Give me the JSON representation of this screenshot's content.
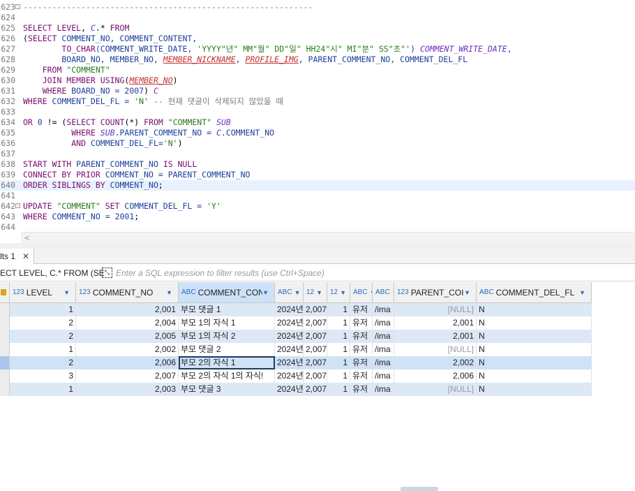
{
  "editor": {
    "lines": [
      {
        "n": "623",
        "fold": "-",
        "tokens": [
          {
            "t": "dash",
            "v": "------------------------------------------------------------"
          }
        ]
      },
      {
        "n": "624",
        "tokens": []
      },
      {
        "n": "625",
        "tokens": [
          {
            "t": "kw",
            "v": "SELECT LEVEL"
          },
          {
            "t": "p",
            "v": ", "
          },
          {
            "t": "al",
            "v": "C"
          },
          {
            "t": "p",
            "v": ".* "
          },
          {
            "t": "kw",
            "v": "FROM"
          }
        ]
      },
      {
        "n": "626",
        "tokens": [
          {
            "t": "p",
            "v": "("
          },
          {
            "t": "kw",
            "v": "SELECT"
          },
          {
            "t": "id",
            "v": " COMMENT_NO, COMMENT_CONTENT,"
          }
        ]
      },
      {
        "n": "627",
        "tokens": [
          {
            "t": "p",
            "v": "        "
          },
          {
            "t": "kw",
            "v": "TO_CHAR"
          },
          {
            "t": "id",
            "v": "(COMMENT_WRITE_DATE, "
          },
          {
            "t": "str",
            "v": "'YYYY\"년\" MM\"월\" DD\"일\" HH24\"시\" MI\"분\" SS\"초\"'"
          },
          {
            "t": "id",
            "v": ") "
          },
          {
            "t": "al",
            "v": "COMMENT_WRITE_DATE"
          },
          {
            "t": "id",
            "v": ","
          }
        ]
      },
      {
        "n": "628",
        "tokens": [
          {
            "t": "id",
            "v": "        BOARD_NO, MEMBER_NO, "
          },
          {
            "t": "er",
            "v": "MEMBER_NICKNAME"
          },
          {
            "t": "id",
            "v": ", "
          },
          {
            "t": "er",
            "v": "PROFILE_IMG"
          },
          {
            "t": "id",
            "v": ", PARENT_COMMENT_NO, COMMENT_DEL_FL"
          }
        ]
      },
      {
        "n": "629",
        "tokens": [
          {
            "t": "kw",
            "v": "    FROM "
          },
          {
            "t": "str",
            "v": "\"COMMENT\""
          }
        ]
      },
      {
        "n": "630",
        "tokens": [
          {
            "t": "kw",
            "v": "    JOIN MEMBER USING"
          },
          {
            "t": "p",
            "v": "("
          },
          {
            "t": "er",
            "v": "MEMBER_NO"
          },
          {
            "t": "p",
            "v": ")"
          }
        ]
      },
      {
        "n": "631",
        "tokens": [
          {
            "t": "kw",
            "v": "    WHERE"
          },
          {
            "t": "id",
            "v": " BOARD_NO = "
          },
          {
            "t": "nm",
            "v": "2007"
          },
          {
            "t": "p",
            "v": ") "
          },
          {
            "t": "al",
            "v": "C"
          }
        ]
      },
      {
        "n": "632",
        "tokens": [
          {
            "t": "kw",
            "v": "WHERE"
          },
          {
            "t": "id",
            "v": " COMMENT_DEL_FL = "
          },
          {
            "t": "str",
            "v": "'N'"
          },
          {
            "t": "cm",
            "v": " -- 현재 댓글이 삭제되지 않았을 때"
          }
        ]
      },
      {
        "n": "633",
        "tokens": []
      },
      {
        "n": "634",
        "tokens": [
          {
            "t": "kw",
            "v": "OR "
          },
          {
            "t": "nm",
            "v": "0"
          },
          {
            "t": "p",
            "v": " != ("
          },
          {
            "t": "kw",
            "v": "SELECT COUNT"
          },
          {
            "t": "p",
            "v": "(*) "
          },
          {
            "t": "kw",
            "v": "FROM "
          },
          {
            "t": "str",
            "v": "\"COMMENT\""
          },
          {
            "t": "p",
            "v": " "
          },
          {
            "t": "al",
            "v": "SUB"
          }
        ]
      },
      {
        "n": "635",
        "tokens": [
          {
            "t": "kw",
            "v": "          WHERE "
          },
          {
            "t": "al",
            "v": "SUB"
          },
          {
            "t": "id",
            "v": ".PARENT_COMMENT_NO = "
          },
          {
            "t": "al",
            "v": "C"
          },
          {
            "t": "id",
            "v": ".COMMENT_NO"
          }
        ]
      },
      {
        "n": "636",
        "tokens": [
          {
            "t": "kw",
            "v": "          AND"
          },
          {
            "t": "id",
            "v": " COMMENT_DEL_FL="
          },
          {
            "t": "str",
            "v": "'N'"
          },
          {
            "t": "p",
            "v": ")"
          }
        ]
      },
      {
        "n": "637",
        "tokens": []
      },
      {
        "n": "638",
        "tokens": [
          {
            "t": "kw",
            "v": "START WITH"
          },
          {
            "t": "id",
            "v": " PARENT_COMMENT_NO "
          },
          {
            "t": "kw",
            "v": "IS NULL"
          }
        ]
      },
      {
        "n": "639",
        "tokens": [
          {
            "t": "kw",
            "v": "CONNECT BY PRIOR"
          },
          {
            "t": "id",
            "v": " COMMENT_NO = PARENT_COMMENT_NO"
          }
        ]
      },
      {
        "n": "640",
        "hl": true,
        "tokens": [
          {
            "t": "kw",
            "v": "ORDER SIBLINGS BY"
          },
          {
            "t": "id",
            "v": " COMMENT_NO"
          },
          {
            "t": "p",
            "v": ";"
          }
        ]
      },
      {
        "n": "641",
        "tokens": []
      },
      {
        "n": "642",
        "fold": "-",
        "tokens": [
          {
            "t": "kw",
            "v": "UPDATE "
          },
          {
            "t": "str",
            "v": "\"COMMENT\""
          },
          {
            "t": "kw",
            "v": " SET"
          },
          {
            "t": "id",
            "v": " COMMENT_DEL_FL = "
          },
          {
            "t": "str",
            "v": "'Y'"
          }
        ]
      },
      {
        "n": "643",
        "tokens": [
          {
            "t": "kw",
            "v": "WHERE"
          },
          {
            "t": "id",
            "v": " COMMENT_NO = "
          },
          {
            "t": "nm",
            "v": "2001"
          },
          {
            "t": "p",
            "v": ";"
          }
        ]
      },
      {
        "n": "644",
        "tokens": []
      }
    ]
  },
  "results_tab": {
    "label": "lts 1"
  },
  "filter": {
    "query_text": "ECT LEVEL, C.* FROM (SE",
    "placeholder": "Enter a SQL expression to filter results (use Ctrl+Space)"
  },
  "grid": {
    "columns": [
      {
        "type": "123",
        "label": "LEVEL"
      },
      {
        "type": "123",
        "label": "COMMENT_NO"
      },
      {
        "type": "ABC",
        "label": "COMMENT_CON"
      },
      {
        "type": "ABC",
        "label": ""
      },
      {
        "type": "12",
        "label": ""
      },
      {
        "type": "12",
        "label": ""
      },
      {
        "type": "ABC",
        "label": ""
      },
      {
        "type": "ABC",
        "label": ""
      },
      {
        "type": "123",
        "label": "PARENT_COI"
      },
      {
        "type": "ABC",
        "label": "COMMENT_DEL_FL"
      }
    ],
    "rows": [
      [
        "1",
        "2,001",
        "부모 댓글 1",
        "2024년",
        "2,007",
        "1",
        "유저",
        "/ima",
        "[NULL]",
        "N"
      ],
      [
        "2",
        "2,004",
        "부모 1의 자식 1",
        "2024년",
        "2,007",
        "1",
        "유저",
        "/ima",
        "2,001",
        "N"
      ],
      [
        "2",
        "2,005",
        "부모 1의 자식 2",
        "2024년",
        "2,007",
        "1",
        "유저",
        "/ima",
        "2,001",
        "N"
      ],
      [
        "1",
        "2,002",
        "부모 댓글 2",
        "2024년",
        "2,007",
        "1",
        "유저",
        "/ima",
        "[NULL]",
        "N"
      ],
      [
        "2",
        "2,006",
        "부모 2의 자식 1",
        "2024년",
        "2,007",
        "1",
        "유저",
        "/ima",
        "2,002",
        "N"
      ],
      [
        "3",
        "2,007",
        "부모 2의 자식 1의 자식!",
        "2024년",
        "2,007",
        "1",
        "유저",
        "/ima",
        "2,006",
        "N"
      ],
      [
        "1",
        "2,003",
        "부모 댓글 3",
        "2024년",
        "2,007",
        "1",
        "유저",
        "/ima",
        "[NULL]",
        "N"
      ]
    ],
    "selected_row": 4
  }
}
